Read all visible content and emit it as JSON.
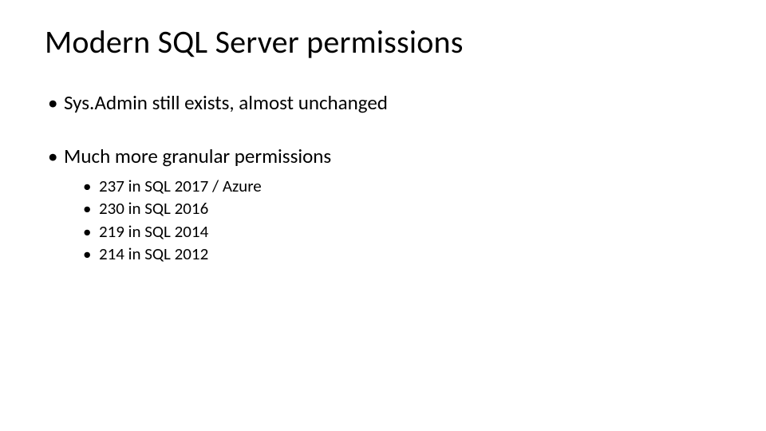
{
  "title": "Modern SQL Server permissions",
  "bullets": [
    {
      "text": "Sys.Admin still exists, almost unchanged",
      "children": []
    },
    {
      "text": "Much more granular permissions",
      "children": [
        {
          "text": "237 in SQL 2017 / Azure"
        },
        {
          "text": "230 in SQL 2016"
        },
        {
          "text": "219 in SQL 2014"
        },
        {
          "text": "214 in SQL 2012"
        }
      ]
    }
  ]
}
